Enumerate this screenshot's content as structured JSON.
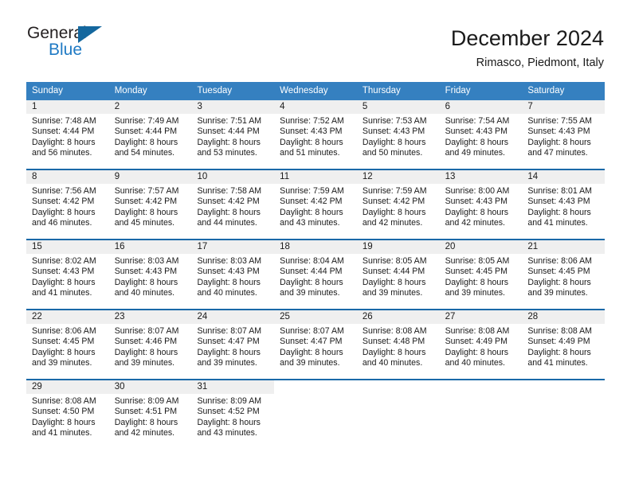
{
  "logo": {
    "word_one": "General",
    "word_two": "Blue",
    "triangle_icon": "blue-triangle-icon",
    "accent_color": "#1f7ac4",
    "triangle_color": "#14679e"
  },
  "header": {
    "title": "December 2024",
    "location": "Rimasco, Piedmont, Italy"
  },
  "theme": {
    "header_blue": "#3580c0",
    "row_border_blue": "#1a69a8",
    "date_band_gray": "#efefef"
  },
  "calendar": {
    "day_headers": [
      "Sunday",
      "Monday",
      "Tuesday",
      "Wednesday",
      "Thursday",
      "Friday",
      "Saturday"
    ],
    "weeks": [
      [
        {
          "day": "1",
          "lines": [
            "Sunrise: 7:48 AM",
            "Sunset: 4:44 PM",
            "Daylight: 8 hours",
            "and 56 minutes."
          ]
        },
        {
          "day": "2",
          "lines": [
            "Sunrise: 7:49 AM",
            "Sunset: 4:44 PM",
            "Daylight: 8 hours",
            "and 54 minutes."
          ]
        },
        {
          "day": "3",
          "lines": [
            "Sunrise: 7:51 AM",
            "Sunset: 4:44 PM",
            "Daylight: 8 hours",
            "and 53 minutes."
          ]
        },
        {
          "day": "4",
          "lines": [
            "Sunrise: 7:52 AM",
            "Sunset: 4:43 PM",
            "Daylight: 8 hours",
            "and 51 minutes."
          ]
        },
        {
          "day": "5",
          "lines": [
            "Sunrise: 7:53 AM",
            "Sunset: 4:43 PM",
            "Daylight: 8 hours",
            "and 50 minutes."
          ]
        },
        {
          "day": "6",
          "lines": [
            "Sunrise: 7:54 AM",
            "Sunset: 4:43 PM",
            "Daylight: 8 hours",
            "and 49 minutes."
          ]
        },
        {
          "day": "7",
          "lines": [
            "Sunrise: 7:55 AM",
            "Sunset: 4:43 PM",
            "Daylight: 8 hours",
            "and 47 minutes."
          ]
        }
      ],
      [
        {
          "day": "8",
          "lines": [
            "Sunrise: 7:56 AM",
            "Sunset: 4:42 PM",
            "Daylight: 8 hours",
            "and 46 minutes."
          ]
        },
        {
          "day": "9",
          "lines": [
            "Sunrise: 7:57 AM",
            "Sunset: 4:42 PM",
            "Daylight: 8 hours",
            "and 45 minutes."
          ]
        },
        {
          "day": "10",
          "lines": [
            "Sunrise: 7:58 AM",
            "Sunset: 4:42 PM",
            "Daylight: 8 hours",
            "and 44 minutes."
          ]
        },
        {
          "day": "11",
          "lines": [
            "Sunrise: 7:59 AM",
            "Sunset: 4:42 PM",
            "Daylight: 8 hours",
            "and 43 minutes."
          ]
        },
        {
          "day": "12",
          "lines": [
            "Sunrise: 7:59 AM",
            "Sunset: 4:42 PM",
            "Daylight: 8 hours",
            "and 42 minutes."
          ]
        },
        {
          "day": "13",
          "lines": [
            "Sunrise: 8:00 AM",
            "Sunset: 4:43 PM",
            "Daylight: 8 hours",
            "and 42 minutes."
          ]
        },
        {
          "day": "14",
          "lines": [
            "Sunrise: 8:01 AM",
            "Sunset: 4:43 PM",
            "Daylight: 8 hours",
            "and 41 minutes."
          ]
        }
      ],
      [
        {
          "day": "15",
          "lines": [
            "Sunrise: 8:02 AM",
            "Sunset: 4:43 PM",
            "Daylight: 8 hours",
            "and 41 minutes."
          ]
        },
        {
          "day": "16",
          "lines": [
            "Sunrise: 8:03 AM",
            "Sunset: 4:43 PM",
            "Daylight: 8 hours",
            "and 40 minutes."
          ]
        },
        {
          "day": "17",
          "lines": [
            "Sunrise: 8:03 AM",
            "Sunset: 4:43 PM",
            "Daylight: 8 hours",
            "and 40 minutes."
          ]
        },
        {
          "day": "18",
          "lines": [
            "Sunrise: 8:04 AM",
            "Sunset: 4:44 PM",
            "Daylight: 8 hours",
            "and 39 minutes."
          ]
        },
        {
          "day": "19",
          "lines": [
            "Sunrise: 8:05 AM",
            "Sunset: 4:44 PM",
            "Daylight: 8 hours",
            "and 39 minutes."
          ]
        },
        {
          "day": "20",
          "lines": [
            "Sunrise: 8:05 AM",
            "Sunset: 4:45 PM",
            "Daylight: 8 hours",
            "and 39 minutes."
          ]
        },
        {
          "day": "21",
          "lines": [
            "Sunrise: 8:06 AM",
            "Sunset: 4:45 PM",
            "Daylight: 8 hours",
            "and 39 minutes."
          ]
        }
      ],
      [
        {
          "day": "22",
          "lines": [
            "Sunrise: 8:06 AM",
            "Sunset: 4:45 PM",
            "Daylight: 8 hours",
            "and 39 minutes."
          ]
        },
        {
          "day": "23",
          "lines": [
            "Sunrise: 8:07 AM",
            "Sunset: 4:46 PM",
            "Daylight: 8 hours",
            "and 39 minutes."
          ]
        },
        {
          "day": "24",
          "lines": [
            "Sunrise: 8:07 AM",
            "Sunset: 4:47 PM",
            "Daylight: 8 hours",
            "and 39 minutes."
          ]
        },
        {
          "day": "25",
          "lines": [
            "Sunrise: 8:07 AM",
            "Sunset: 4:47 PM",
            "Daylight: 8 hours",
            "and 39 minutes."
          ]
        },
        {
          "day": "26",
          "lines": [
            "Sunrise: 8:08 AM",
            "Sunset: 4:48 PM",
            "Daylight: 8 hours",
            "and 40 minutes."
          ]
        },
        {
          "day": "27",
          "lines": [
            "Sunrise: 8:08 AM",
            "Sunset: 4:49 PM",
            "Daylight: 8 hours",
            "and 40 minutes."
          ]
        },
        {
          "day": "28",
          "lines": [
            "Sunrise: 8:08 AM",
            "Sunset: 4:49 PM",
            "Daylight: 8 hours",
            "and 41 minutes."
          ]
        }
      ],
      [
        {
          "day": "29",
          "lines": [
            "Sunrise: 8:08 AM",
            "Sunset: 4:50 PM",
            "Daylight: 8 hours",
            "and 41 minutes."
          ]
        },
        {
          "day": "30",
          "lines": [
            "Sunrise: 8:09 AM",
            "Sunset: 4:51 PM",
            "Daylight: 8 hours",
            "and 42 minutes."
          ]
        },
        {
          "day": "31",
          "lines": [
            "Sunrise: 8:09 AM",
            "Sunset: 4:52 PM",
            "Daylight: 8 hours",
            "and 43 minutes."
          ]
        },
        {
          "day": "",
          "lines": []
        },
        {
          "day": "",
          "lines": []
        },
        {
          "day": "",
          "lines": []
        },
        {
          "day": "",
          "lines": []
        }
      ]
    ]
  }
}
